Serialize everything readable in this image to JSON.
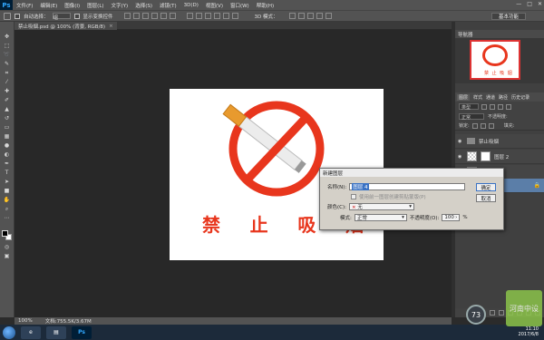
{
  "app": {
    "logo": "Ps",
    "win_controls": [
      "—",
      "□",
      "✕"
    ]
  },
  "menu": [
    "文件(F)",
    "编辑(E)",
    "图像(I)",
    "图层(L)",
    "文字(Y)",
    "选择(S)",
    "滤镜(T)",
    "3D(D)",
    "视图(V)",
    "窗口(W)",
    "帮助(H)"
  ],
  "options": {
    "auto_select_label": "自动选择：",
    "auto_select_value": "组",
    "show_transform_label": "显示变换控件",
    "mode_3d_label": "3D 模式：",
    "workspace": "基本功能"
  },
  "document": {
    "tab_title": "禁止吸烟.psd @ 100% (背景, RGB/8)",
    "tab_close": "×",
    "sign_chars": [
      "禁",
      "止",
      "吸",
      "烟"
    ]
  },
  "navigator": {
    "title": "导航器",
    "thumb_text": "禁 止 吸 烟"
  },
  "layers_panel": {
    "tabs": [
      "图层",
      "样式",
      "通道",
      "路径",
      "历史记录"
    ],
    "filter_kind": "类型",
    "blend_mode": "正常",
    "opacity_label": "不透明度:",
    "lock_label": "锁定:",
    "fill_label": "填充:",
    "layers": [
      {
        "name": "禁止吸烟",
        "type": "folder"
      },
      {
        "name": "图层 2",
        "type": "layer"
      },
      {
        "name": "",
        "type": "layer"
      },
      {
        "name": "",
        "type": "layer-selected"
      }
    ]
  },
  "dialog": {
    "title": "新建图层",
    "name_label": "名称(N):",
    "name_value": "图层 4",
    "clip_label": "使用前一图层创建剪贴蒙版(P)",
    "color_label": "颜色(C):",
    "color_swatch": "×",
    "color_value": "无",
    "mode_label": "模式:",
    "mode_value": "正常",
    "opacity_label": "不透明度(O):",
    "opacity_value": "100",
    "opacity_unit": "%",
    "ok_label": "确定",
    "cancel_label": "取消"
  },
  "status": {
    "zoom": "100%",
    "doc_size": "文档:755.5K/3.67M"
  },
  "taskbar": {
    "time": "11:10",
    "date": "2017/6/8",
    "badge": "73",
    "watermark": "河南中设"
  },
  "colors": {
    "sign_red": "#e8361d",
    "selection_blue": "#5b7ea8"
  }
}
